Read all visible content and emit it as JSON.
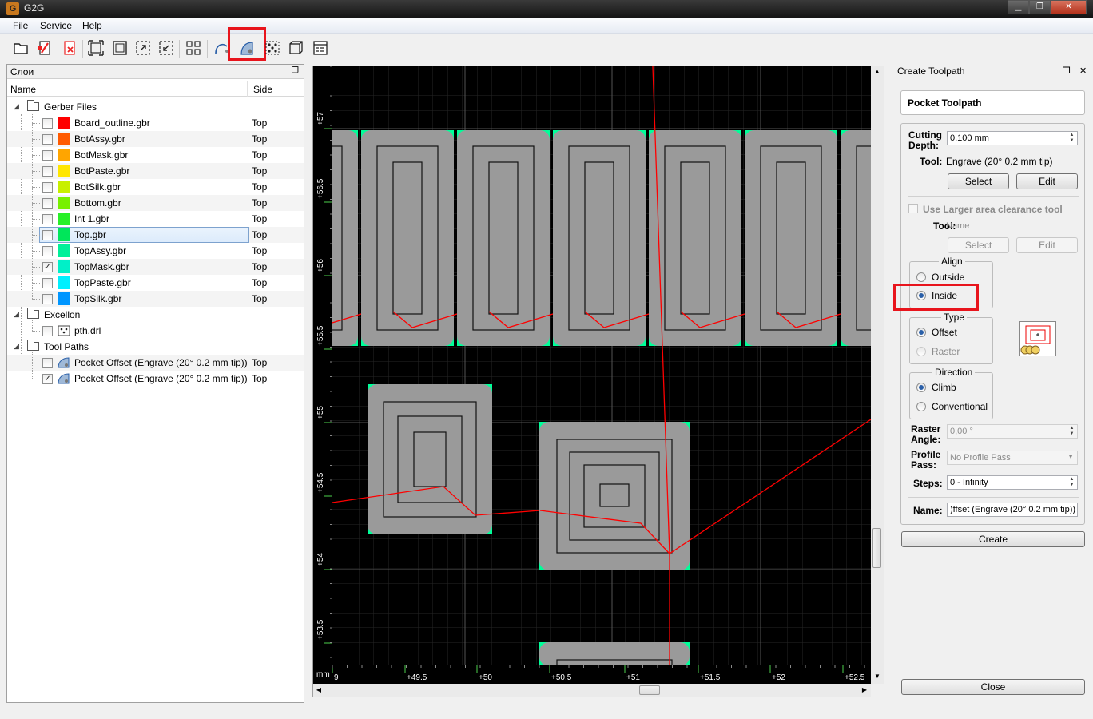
{
  "window": {
    "title": "G2G",
    "app_icon": "G"
  },
  "menu": {
    "file": "File",
    "service": "Service",
    "help": "Help"
  },
  "layers": {
    "title": "Слои",
    "col_name": "Name",
    "col_side": "Side",
    "groups": {
      "gerber": "Gerber Files",
      "excellon": "Excellon",
      "toolpaths": "Tool Paths"
    },
    "gerber_files": [
      {
        "name": "Board_outline.gbr",
        "side": "Top",
        "color": "#ff0000",
        "checked": false
      },
      {
        "name": "BotAssy.gbr",
        "side": "Top",
        "color": "#ff5a00",
        "checked": false
      },
      {
        "name": "BotMask.gbr",
        "side": "Top",
        "color": "#ffa500",
        "checked": false
      },
      {
        "name": "BotPaste.gbr",
        "side": "Top",
        "color": "#ffe600",
        "checked": false
      },
      {
        "name": "BotSilk.gbr",
        "side": "Top",
        "color": "#c8f000",
        "checked": false
      },
      {
        "name": "Bottom.gbr",
        "side": "Top",
        "color": "#78f000",
        "checked": false
      },
      {
        "name": "Int 1.gbr",
        "side": "Top",
        "color": "#28f028",
        "checked": false
      },
      {
        "name": "Top.gbr",
        "side": "Top",
        "color": "#00e65a",
        "checked": false
      },
      {
        "name": "TopAssy.gbr",
        "side": "Top",
        "color": "#00f09a",
        "checked": false
      },
      {
        "name": "TopMask.gbr",
        "side": "Top",
        "color": "#00f0c8",
        "checked": true
      },
      {
        "name": "TopPaste.gbr",
        "side": "Top",
        "color": "#00f0ff",
        "checked": false
      },
      {
        "name": "TopSilk.gbr",
        "side": "Top",
        "color": "#0096ff",
        "checked": false
      }
    ],
    "excellon_files": [
      {
        "name": "pth.drl",
        "side": "",
        "checked": false
      }
    ],
    "toolpaths": [
      {
        "name": "Pocket Offset (Engrave (20° 0.2 mm tip))",
        "side": "Top",
        "checked": false
      },
      {
        "name": "Pocket Offset (Engrave (20° 0.2 mm tip))",
        "side": "Top",
        "checked": true
      }
    ]
  },
  "canvas": {
    "unit": "mm",
    "x_ticks": [
      "9",
      "+49.5",
      "+50",
      "+50.5",
      "+51",
      "+51.5",
      "+52",
      "+52.5"
    ],
    "y_ticks": [
      "+57",
      "+56.5",
      "+56",
      "+55.5",
      "+55",
      "+54.5",
      "+54",
      "+53.5"
    ],
    "colors": {
      "background": "#000000",
      "pad": "#9a9a9a",
      "mask": "#00ff99",
      "toolpath_move": "#ff0000"
    }
  },
  "toolpath_panel": {
    "title": "Create Toolpath",
    "heading": "Pocket Toolpath",
    "cutting_depth_label": "Cutting Depth:",
    "cutting_depth_value": "0,100 mm",
    "tool_label": "Tool:",
    "tool_value": "Engrave (20° 0.2 mm tip)",
    "select": "Select",
    "edit": "Edit",
    "larger_area_label": "Use Larger area clearance tool",
    "tool2_label": "Tool:",
    "tool2_value": "Name",
    "align": {
      "title": "Align",
      "outside": "Outside",
      "inside": "Inside",
      "selected": "inside"
    },
    "type": {
      "title": "Type",
      "offset": "Offset",
      "raster": "Raster",
      "selected": "offset"
    },
    "direction": {
      "title": "Direction",
      "climb": "Climb",
      "conventional": "Conventional",
      "selected": "climb"
    },
    "raster_angle_label": "Raster Angle:",
    "raster_angle_value": "0,00 °",
    "profile_pass_label": "Profile Pass:",
    "profile_pass_value": "No Profile Pass",
    "steps_label": "Steps:",
    "steps_value": "0 - Infinity",
    "name_label": "Name:",
    "name_value": ")ffset (Engrave (20° 0.2 mm tip))",
    "create": "Create",
    "close": "Close",
    "highlight_color": "#e8141c"
  }
}
